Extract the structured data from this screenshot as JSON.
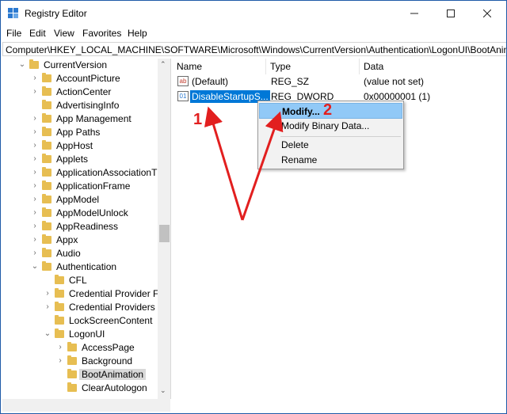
{
  "window": {
    "title": "Registry Editor",
    "minimize_icon": "minimize-icon",
    "maximize_icon": "maximize-icon",
    "close_icon": "close-icon"
  },
  "menu": [
    "File",
    "Edit",
    "View",
    "Favorites",
    "Help"
  ],
  "address_bar": "Computer\\HKEY_LOCAL_MACHINE\\SOFTWARE\\Microsoft\\Windows\\CurrentVersion\\Authentication\\LogonUI\\BootAnimation",
  "tree": [
    {
      "label": "CurrentVersion",
      "expanded": true
    },
    {
      "label": "AccountPicture"
    },
    {
      "label": "ActionCenter"
    },
    {
      "label": "AdvertisingInfo"
    },
    {
      "label": "App Management"
    },
    {
      "label": "App Paths"
    },
    {
      "label": "AppHost"
    },
    {
      "label": "Applets"
    },
    {
      "label": "ApplicationAssociationT"
    },
    {
      "label": "ApplicationFrame"
    },
    {
      "label": "AppModel"
    },
    {
      "label": "AppModelUnlock"
    },
    {
      "label": "AppReadiness"
    },
    {
      "label": "Appx"
    },
    {
      "label": "Audio"
    },
    {
      "label": "Authentication",
      "expanded": true
    },
    {
      "label": "CFL"
    },
    {
      "label": "Credential Provider Fi"
    },
    {
      "label": "Credential Providers"
    },
    {
      "label": "LockScreenContent"
    },
    {
      "label": "LogonUI",
      "expanded": true
    },
    {
      "label": "AccessPage"
    },
    {
      "label": "Background"
    },
    {
      "label": "BootAnimation",
      "selected": true
    },
    {
      "label": "ClearAutologon"
    }
  ],
  "columns": {
    "name": "Name",
    "type": "Type",
    "data": "Data"
  },
  "values": [
    {
      "name": "(Default)",
      "type": "REG_SZ",
      "data": "(value not set)",
      "icon": "string-value-icon"
    },
    {
      "name": "DisableStartupS...",
      "type": "REG_DWORD",
      "data": "0x00000001 (1)",
      "icon": "dword-value-icon"
    }
  ],
  "context_menu": {
    "modify": "Modify...",
    "modify_binary": "Modify Binary Data...",
    "delete": "Delete",
    "rename": "Rename"
  },
  "annotations": {
    "step1": "1",
    "step2": "2",
    "arrow_color": "#e21f1f"
  }
}
